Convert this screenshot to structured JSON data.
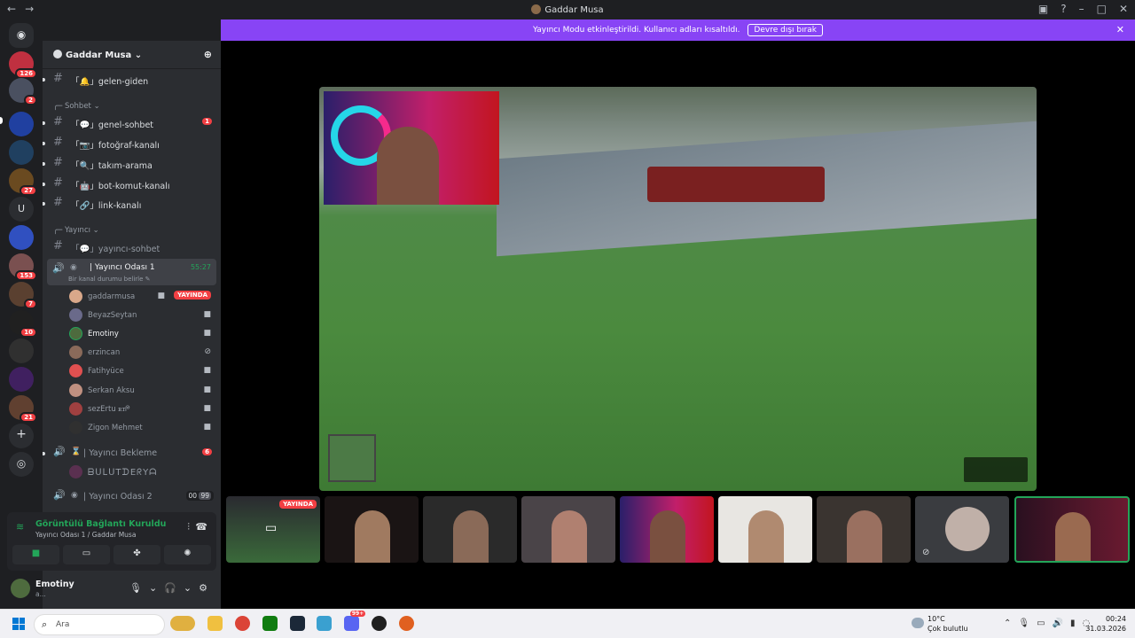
{
  "window": {
    "title": "Gaddar Musa"
  },
  "banner": {
    "text": "Yayıncı Modu etkinleştirildi. Kullanıcı adları kısaltıldı.",
    "button": "Devre dışı bırak"
  },
  "servers": {
    "badges": [
      "126",
      "2",
      "27",
      "153",
      "7",
      "10",
      "21"
    ],
    "letter": "U"
  },
  "sidebar": {
    "server_name": "Gaddar Musa",
    "channels_top": [
      {
        "name": "「🔔」gelen-giden"
      }
    ],
    "category_sohbet": "Sohbet",
    "channels_sohbet": [
      {
        "name": "「💬」genel-sohbet",
        "badge": "1"
      },
      {
        "name": "「📷」fotoğraf-kanalı"
      },
      {
        "name": "「🔍」takım-arama"
      },
      {
        "name": "「🤖」bot-komut-kanalı"
      },
      {
        "name": "「🔗」link-kanalı"
      }
    ],
    "category_yayinci": "Yayıncı",
    "channel_yayinci_sohbet": "「💬」yayıncı-sohbet",
    "voice_channel": {
      "name": "| Yayıncı Odası 1",
      "time": "55:27",
      "status": "Bir kanal durumu belirle"
    },
    "members": [
      {
        "name": "gaddarmusa",
        "live": "YAYINDA"
      },
      {
        "name": "BeyazSeytan"
      },
      {
        "name": "Emotiny"
      },
      {
        "name": "erzincan"
      },
      {
        "name": "Fatihyüce"
      },
      {
        "name": "Serkan Aksu"
      },
      {
        "name": "sezErtu ꭱꭲᖘ"
      },
      {
        "name": "Zigon Mehmet"
      }
    ],
    "waiting_channel": {
      "name": "| Yayıncı Bekleme",
      "badge": "6"
    },
    "waiting_member": "ᗷᑌᒪᑌTᗪEᖇYᗩ",
    "voice_channel_2": {
      "name": "| Yayıncı Odası 2",
      "count_a": "00",
      "count_b": "99"
    }
  },
  "connection": {
    "title": "Görüntülü Bağlantı Kuruldu",
    "subtitle": "Yayıncı Odası 1 / Gaddar Musa"
  },
  "user": {
    "name": "Emotiny",
    "status": "a..."
  },
  "tiles": {
    "live_label": "YAYINDA"
  },
  "taskbar": {
    "search_placeholder": "Ara",
    "notif_count": "99+",
    "weather_temp": "10°C",
    "weather_cond": "Çok bulutlu",
    "time": "00:24",
    "date": "31.03.2026"
  },
  "colors": {
    "accent": "#5865f2",
    "banner": "#8844f5",
    "live": "#f23f43",
    "connected": "#23a559"
  }
}
